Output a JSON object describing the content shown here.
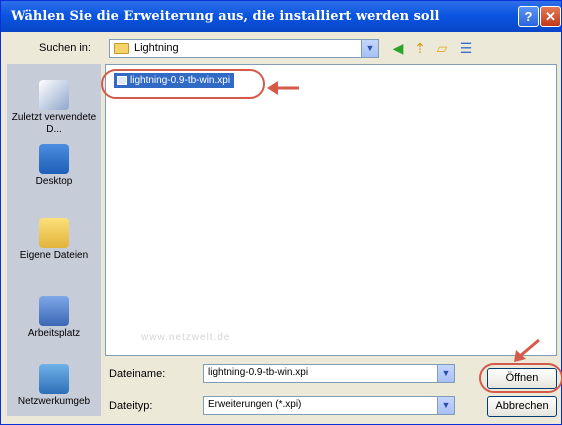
{
  "window": {
    "title": "Wählen Sie die Erweiterung aus, die installiert werden soll"
  },
  "titlebar": {
    "help_label": "?",
    "close_label": "✕"
  },
  "lookin": {
    "label": "Suchen in:",
    "value": "Lightning"
  },
  "toolbar": {
    "icons": [
      "back-icon",
      "up-folder-icon",
      "new-folder-icon",
      "view-menu-icon"
    ]
  },
  "places": [
    {
      "label": "Zuletzt verwendete D...",
      "icon": "recent-documents-icon"
    },
    {
      "label": "Desktop",
      "icon": "desktop-icon"
    },
    {
      "label": "Eigene Dateien",
      "icon": "my-documents-icon"
    },
    {
      "label": "Arbeitsplatz",
      "icon": "my-computer-icon"
    },
    {
      "label": "Netzwerkumgeb",
      "icon": "network-places-icon"
    }
  ],
  "files": [
    {
      "name": "lightning-0.9-tb-win.xpi",
      "selected": true
    }
  ],
  "watermark": "www.netzwelt.de",
  "filename": {
    "label": "Dateiname:",
    "value": "lightning-0.9-tb-win.xpi"
  },
  "filetype": {
    "label": "Dateityp:",
    "value": "Erweiterungen (*.xpi)"
  },
  "buttons": {
    "open": "Öffnen",
    "cancel": "Abbrechen"
  },
  "colors": {
    "titlebar": "#0b55e0",
    "selection": "#316ac5",
    "annotation": "#d45a4a",
    "dialog_bg": "#ece9d8"
  }
}
